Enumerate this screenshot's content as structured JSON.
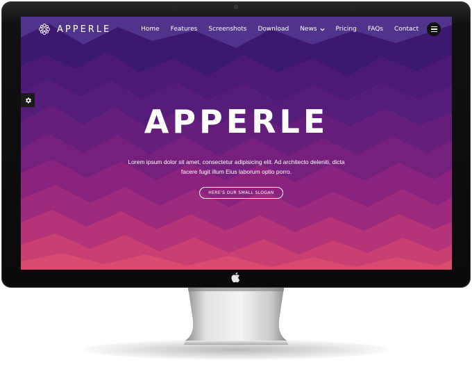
{
  "brand": {
    "name": "APPERLE",
    "icon": "mandala-logo-icon"
  },
  "nav": {
    "items": [
      {
        "label": "Home"
      },
      {
        "label": "Features"
      },
      {
        "label": "Screenshots"
      },
      {
        "label": "Download"
      },
      {
        "label": "News",
        "has_dropdown": true
      },
      {
        "label": "Pricing"
      },
      {
        "label": "FAQs"
      },
      {
        "label": "Contact"
      }
    ],
    "menu_icon": "hamburger-icon"
  },
  "settings_icon": "gear-icon",
  "hero": {
    "title": "APPERLE",
    "text": "Lorem ipsum dolor sit amet, consectetur adipisicing elit. Ad architecto deleniti, dicta facere fugit illum Eius laborum optio porro.",
    "button_label": "HERE'S OUR SMALL SLOGAN"
  },
  "colors": {
    "bg_top": "#3f1a72",
    "bg_mid": "#6e1d7a",
    "bg_bottom": "#d8466f",
    "bezel": "#0d0d0e"
  },
  "hardware_icon": "apple-logo-icon"
}
